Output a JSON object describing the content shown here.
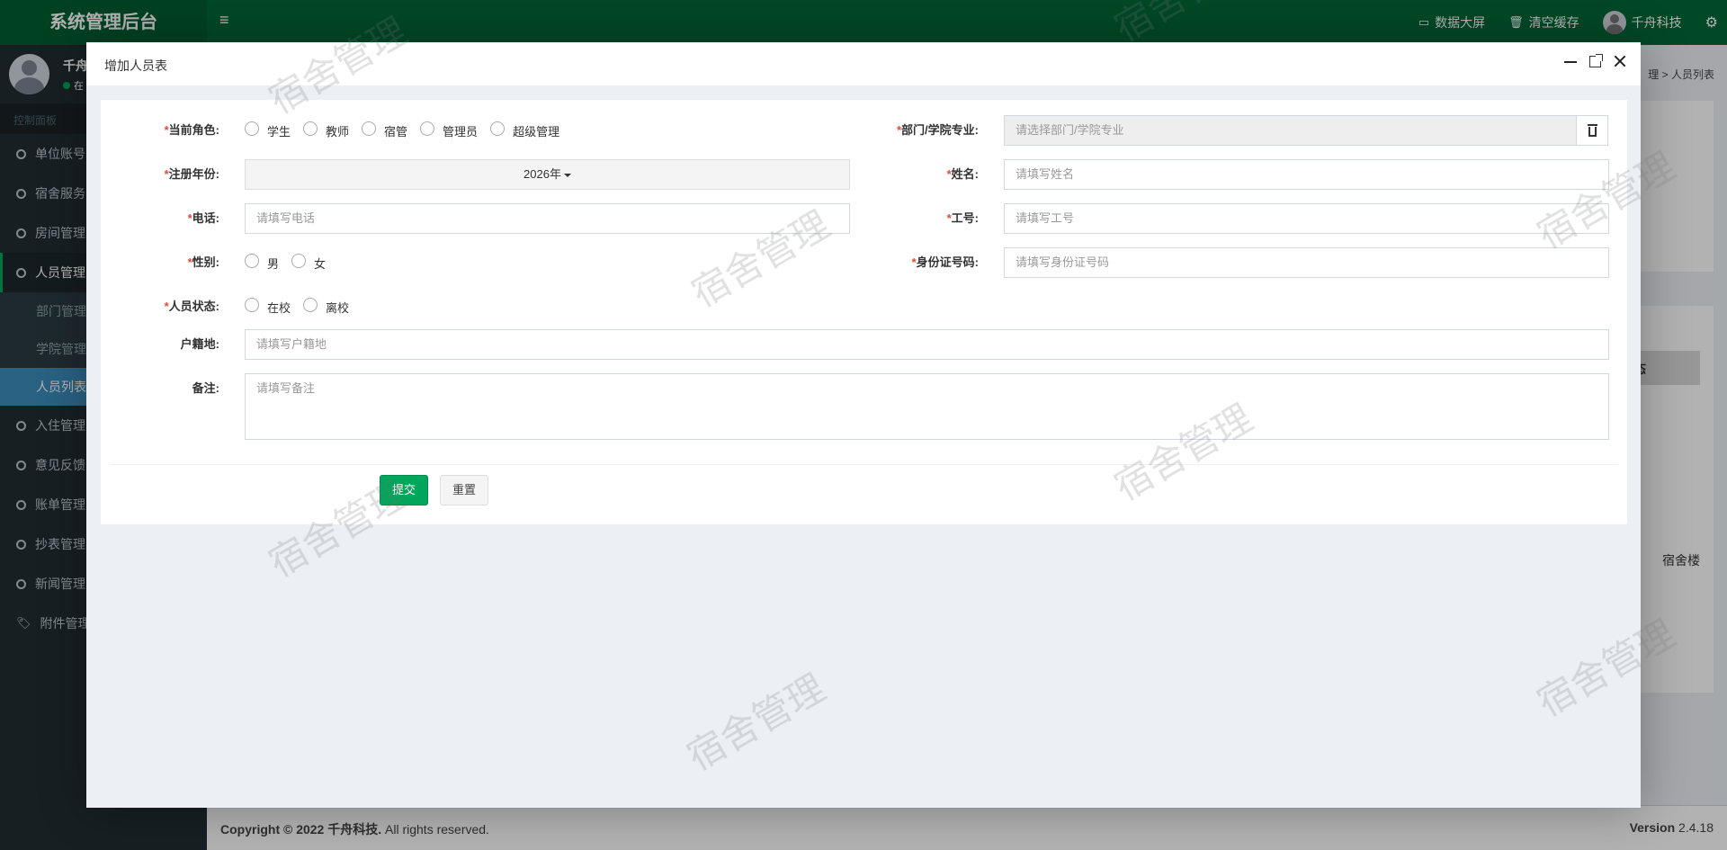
{
  "app": {
    "brand": "系统管理后台",
    "topnav": {
      "data_screen": "数据大屏",
      "clear_cache": "清空缓存",
      "user": "千舟科技"
    }
  },
  "sidebar": {
    "user_name": "千舟",
    "user_status": "在",
    "header": "控制面板",
    "items": [
      {
        "label": "单位账号"
      },
      {
        "label": "宿舍服务"
      },
      {
        "label": "房间管理"
      },
      {
        "label": "人员管理"
      },
      {
        "label": "部门管理"
      },
      {
        "label": "学院管理"
      },
      {
        "label": "人员列表"
      },
      {
        "label": "入住管理"
      },
      {
        "label": "意见反馈"
      },
      {
        "label": "账单管理"
      },
      {
        "label": "抄表管理"
      },
      {
        "label": "新闻管理"
      },
      {
        "label": "附件管理"
      }
    ]
  },
  "background": {
    "breadcrumb_tail": "理",
    "breadcrumb_current": "人员列表",
    "table_header_fragment": "态",
    "table_cell_fragment": "宿舍楼"
  },
  "footer": {
    "copyright_prefix": "Copyright © 2022 ",
    "company": "千舟科技.",
    "rights": " All rights reserved.",
    "version_label": "Version",
    "version": " 2.4.18"
  },
  "watermark": "宿舍管理",
  "modal": {
    "title": "增加人员表",
    "form": {
      "role": {
        "label": "当前角色:",
        "options": [
          "学生",
          "教师",
          "宿管",
          "管理员",
          "超级管理"
        ]
      },
      "dept": {
        "label": "部门/学院专业:",
        "placeholder": "请选择部门/学院专业"
      },
      "year": {
        "label": "注册年份:",
        "value": "2026年"
      },
      "name": {
        "label": "姓名:",
        "placeholder": "请填写姓名"
      },
      "phone": {
        "label": "电话:",
        "placeholder": "请填写电话"
      },
      "job_no": {
        "label": "工号:",
        "placeholder": "请填写工号"
      },
      "gender": {
        "label": "性别:",
        "options": [
          "男",
          "女"
        ]
      },
      "id_card": {
        "label": "身份证号码:",
        "placeholder": "请填写身份证号码"
      },
      "status": {
        "label": "人员状态:",
        "options": [
          "在校",
          "离校"
        ]
      },
      "hometown": {
        "label": "户籍地:",
        "placeholder": "请填写户籍地"
      },
      "remark": {
        "label": "备注:",
        "placeholder": "请填写备注"
      }
    },
    "buttons": {
      "submit": "提交",
      "reset": "重置"
    }
  }
}
